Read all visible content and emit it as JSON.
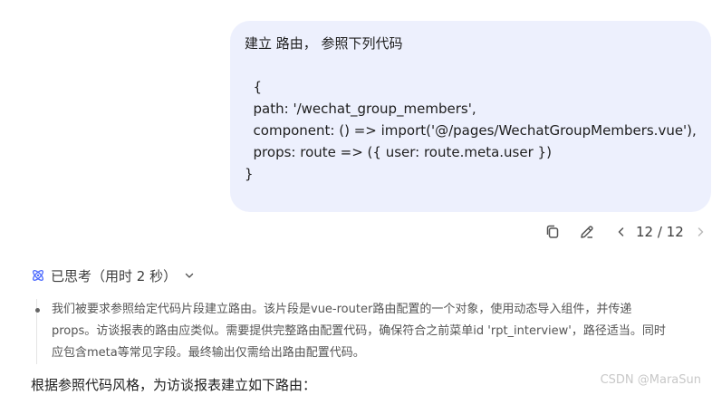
{
  "user_message": {
    "lines": [
      "建立 路由， 参照下列代码",
      "",
      "  {",
      "  path: '/wechat_group_members',",
      "  component: () => import('@/pages/WechatGroupMembers.vue'),",
      "  props: route => ({ user: route.meta.user })",
      "}"
    ]
  },
  "message_actions": {
    "copy_icon": "copy-icon",
    "edit_icon": "edit-icon",
    "prev_icon": "chevron-left-icon",
    "next_icon": "chevron-right-icon",
    "pager": "12 / 12"
  },
  "thinking": {
    "toggle_label": "已思考（用时 2 秒）",
    "lines": [
      "我们被要求参照给定代码片段建立路由。该片段是vue-router路由配置的一个对象，使用动态导入组件，并传递",
      "props。访谈报表的路由应类似。需要提供完整路由配置代码，确保符合之前菜单id 'rpt_interview'，路径适当。同时",
      "应包含meta等常见字段。最终输出仅需给出路由配置代码。"
    ]
  },
  "answer": {
    "intro": "根据参照代码风格，为访谈报表建立如下路由："
  },
  "watermark": "CSDN @MaraSun",
  "colors": {
    "bubble_bg": "#edf0fd",
    "accent": "#4d6bfe",
    "thinking_text": "#555555"
  }
}
